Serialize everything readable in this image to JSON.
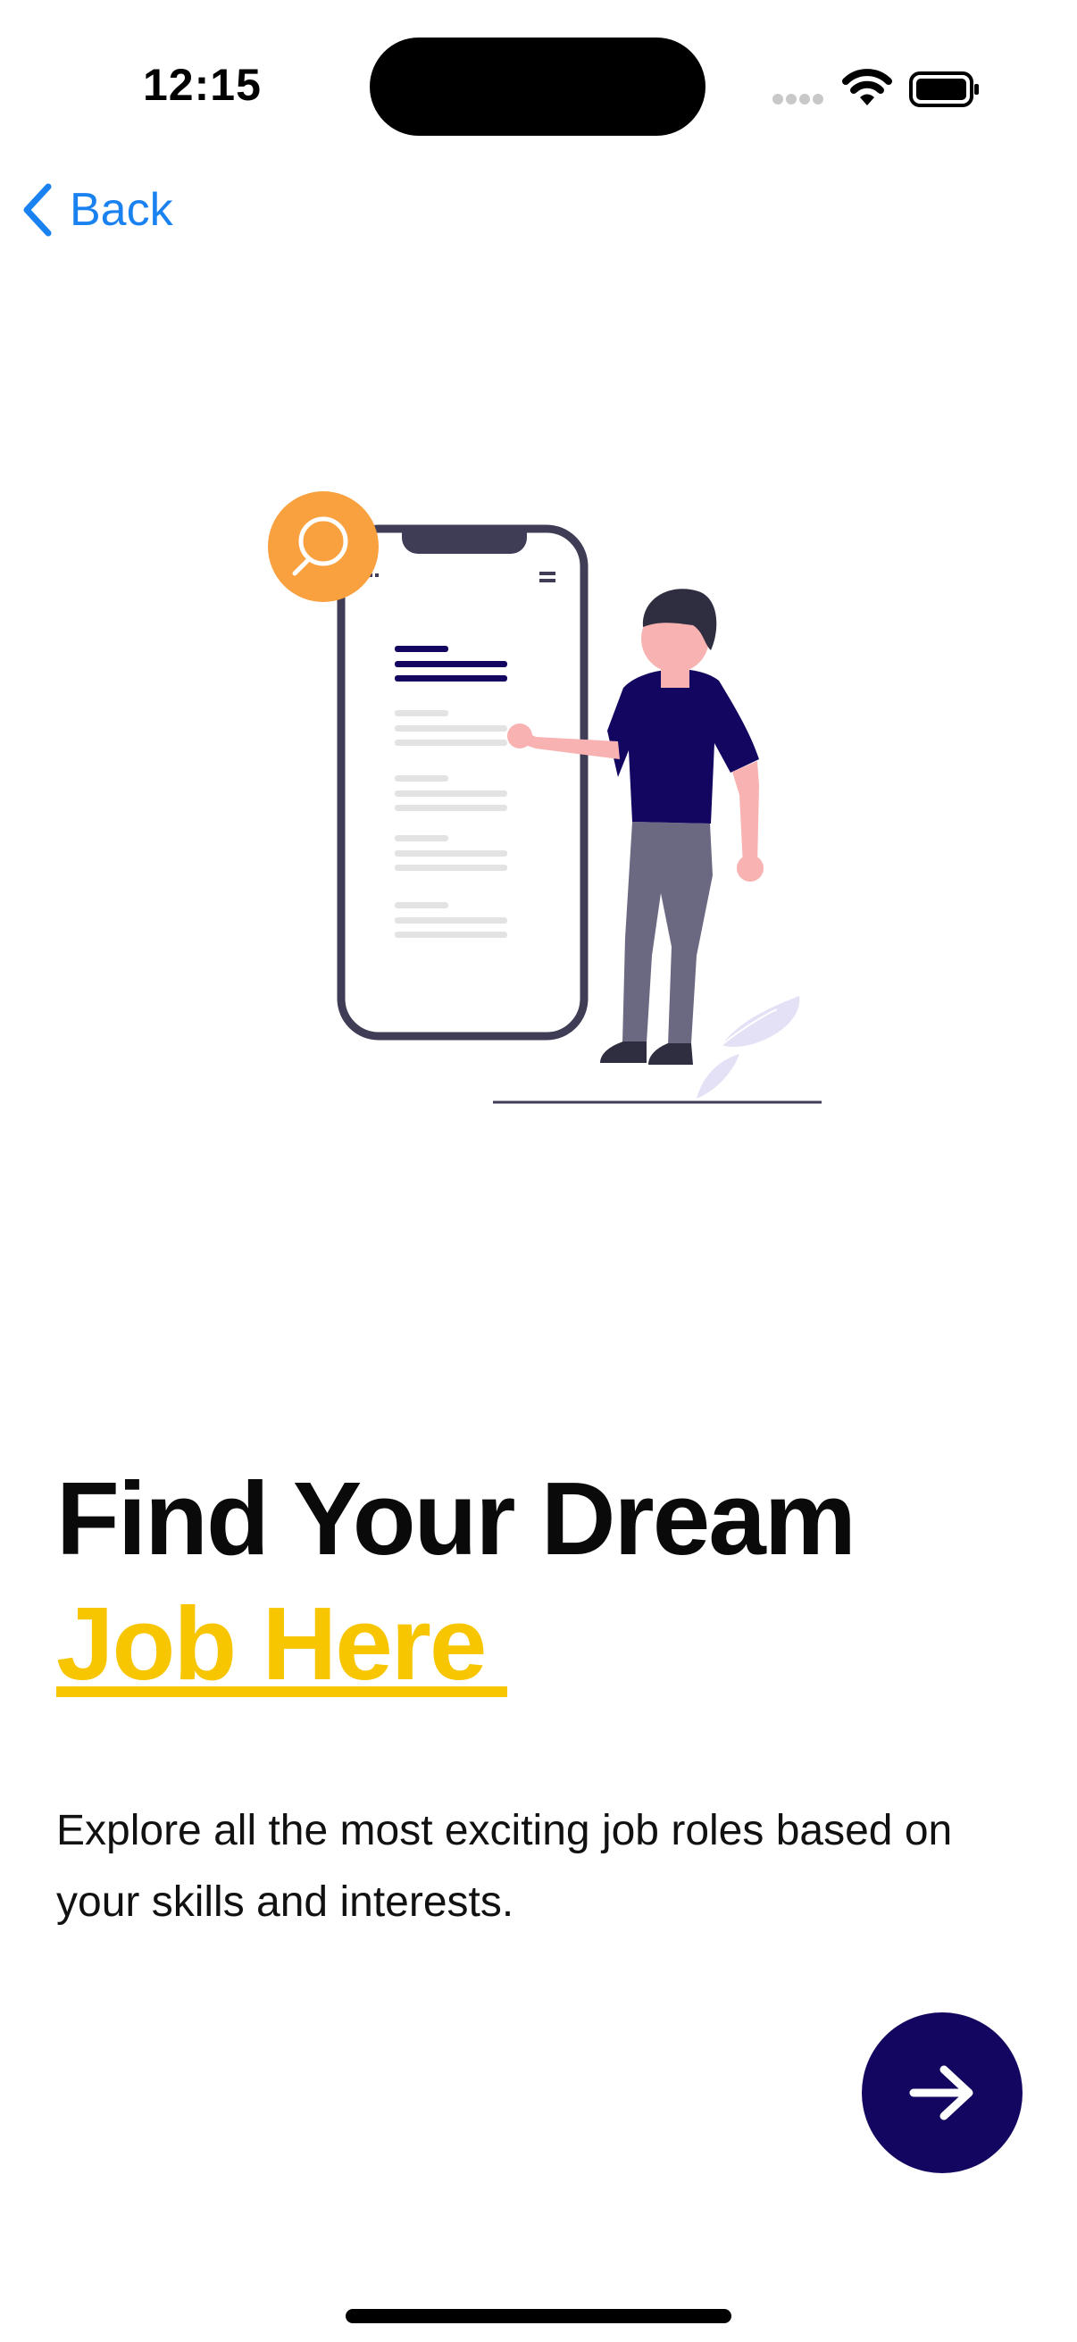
{
  "status_bar": {
    "time": "12:15"
  },
  "nav": {
    "back_label": "Back"
  },
  "headline": {
    "line1": "Find Your Dream",
    "line2": "Job Here"
  },
  "subtitle": "Explore all the most exciting job roles based on your skills and interests.",
  "icons": {
    "back": "chevron-left-icon",
    "next": "arrow-right-icon",
    "search": "search-icon"
  },
  "colors": {
    "accent_blue": "#1a82f0",
    "highlight_yellow": "#f7c600",
    "button_navy": "#130660",
    "search_orange": "#f9a03f"
  }
}
